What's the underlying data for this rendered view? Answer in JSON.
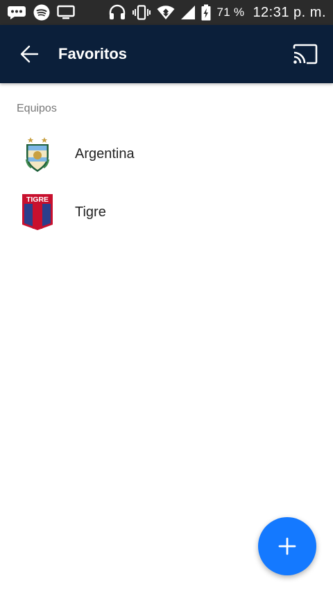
{
  "status_bar": {
    "battery_text": "71 %",
    "time": "12:31 p. m.",
    "left_icons": [
      "chat-bubble-icon",
      "spotify-icon",
      "screen-cast-icon"
    ],
    "right_icons": [
      "headset-icon",
      "vibrate-icon",
      "wifi-icon",
      "signal-icon",
      "battery-charging-icon"
    ]
  },
  "app_bar": {
    "title": "Favoritos",
    "background": "#0b1f3a",
    "back_icon": "arrow-left-icon",
    "cast_icon": "cast-icon"
  },
  "section": {
    "header": "Equipos",
    "items": [
      {
        "name": "Argentina",
        "crest_icon": "afa-crest-icon"
      },
      {
        "name": "Tigre",
        "crest_icon": "tigre-crest-icon",
        "crest_text": "TIGRE"
      }
    ]
  },
  "fab": {
    "icon": "plus-icon",
    "color": "#1479ff"
  }
}
